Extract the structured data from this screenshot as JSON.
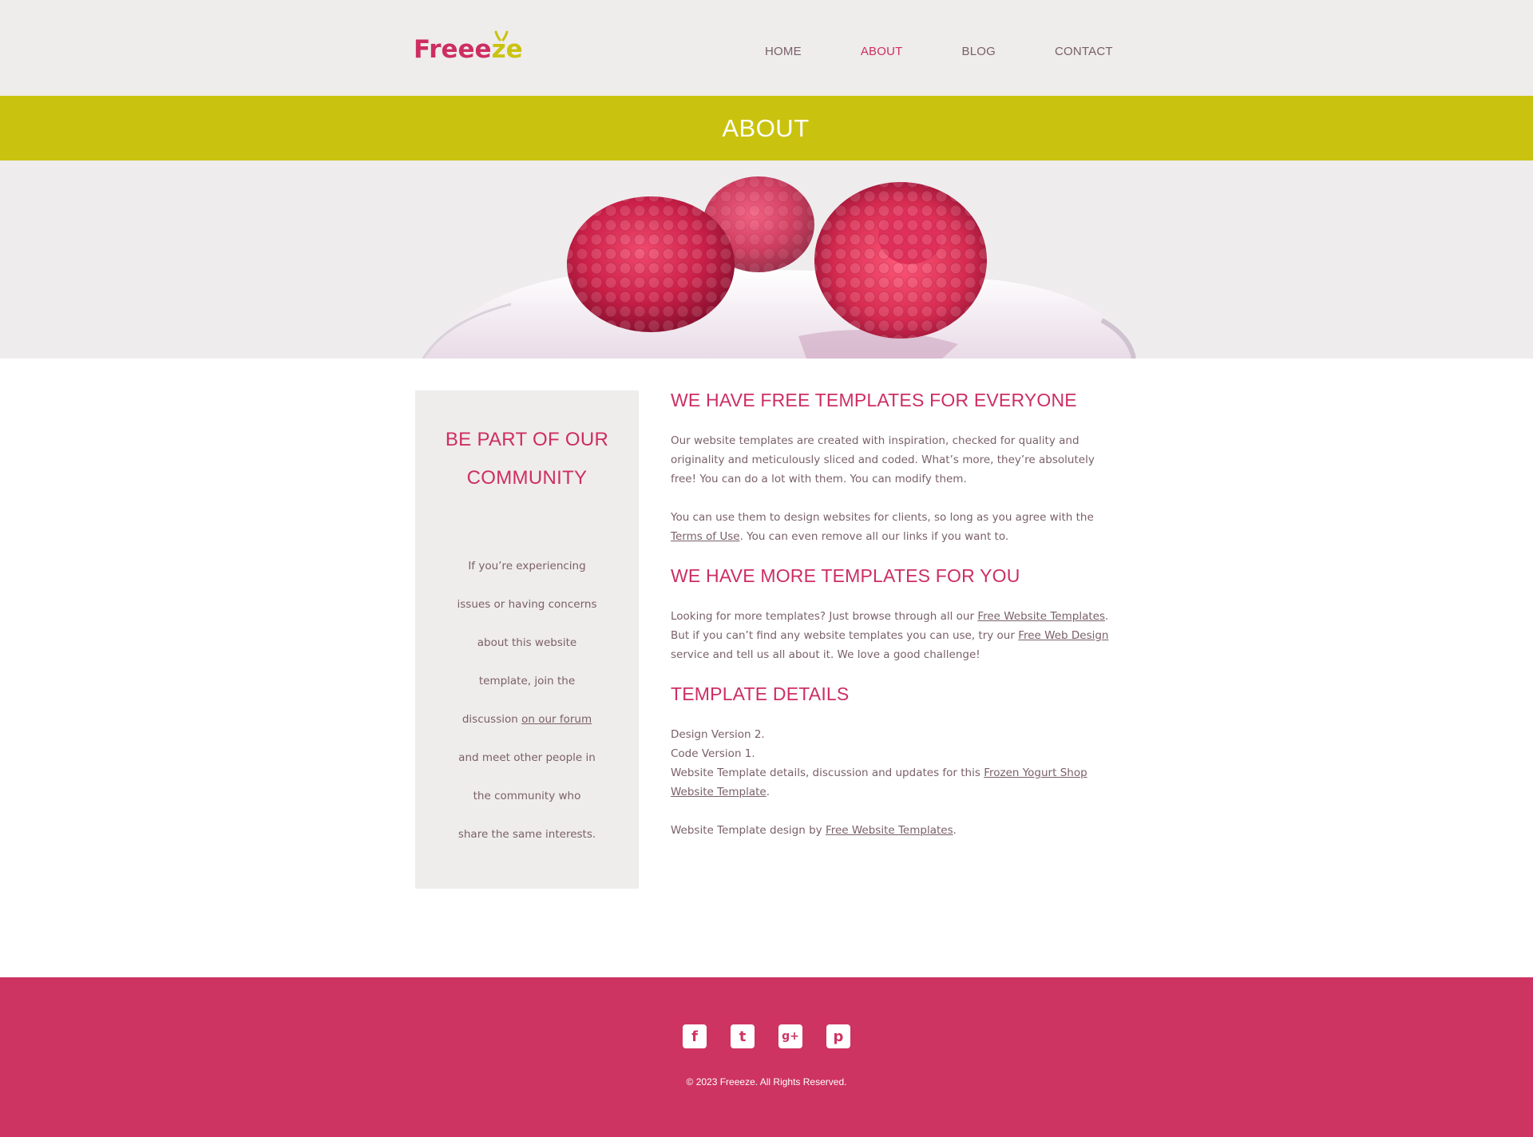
{
  "header": {
    "logo": {
      "text_main": "Freee",
      "text_accent": "ze"
    },
    "nav": [
      {
        "label": "HOME",
        "active": false
      },
      {
        "label": "ABOUT",
        "active": true
      },
      {
        "label": "BLOG",
        "active": false
      },
      {
        "label": "CONTACT",
        "active": false
      }
    ]
  },
  "page_title": "ABOUT",
  "sidebar": {
    "heading": "BE PART OF OUR COMMUNITY",
    "text_before_link": "If you’re experiencing issues or having concerns about this website template, join the discussion ",
    "link_text": "on our forum",
    "text_after_link": " and meet other people in the community who share the same interests."
  },
  "main": {
    "section1": {
      "heading": "WE HAVE FREE TEMPLATES FOR EVERYONE",
      "p1": "Our website templates are created with inspiration, checked for quality and originality and meticulously sliced and coded. What’s more, they’re absolutely free! You can do a lot with them. You can modify them.",
      "p2_before": "You can use them to design websites for clients, so long as you agree with the ",
      "p2_link": "Terms of Use",
      "p2_after": ". You can even remove all our links if you want to."
    },
    "section2": {
      "heading": "WE HAVE MORE TEMPLATES FOR YOU",
      "p_before": "Looking for more templates? Just browse through all our ",
      "link1": "Free Website Templates",
      "p_middle": ". But if you can’t find any website templates you can use, try our ",
      "link2": "Free Web Design",
      "p_after": " service and tell us all about it. We love a good challenge!"
    },
    "section3": {
      "heading": "TEMPLATE DETAILS",
      "line1": "Design Version 2.",
      "line2": "Code Version 1.",
      "line3_before": "Website Template details, discussion and updates for this ",
      "line3_link": "Frozen Yogurt Shop Website Template",
      "line3_after": ".",
      "credit_before": "Website Template design by ",
      "credit_link": "Free Website Templates",
      "credit_after": "."
    }
  },
  "footer": {
    "social": [
      {
        "name": "facebook",
        "glyph": "f"
      },
      {
        "name": "twitter",
        "glyph": "t"
      },
      {
        "name": "google-plus",
        "glyph": "g+"
      },
      {
        "name": "pinterest",
        "glyph": "p"
      }
    ],
    "copyright": "© 2023 Freeeze. All Rights Reserved."
  },
  "colors": {
    "brand_pink": "#cd2e62",
    "accent_lime": "#c9c30f",
    "footer_pink": "#cd3462",
    "panel_grey": "#efecec"
  }
}
